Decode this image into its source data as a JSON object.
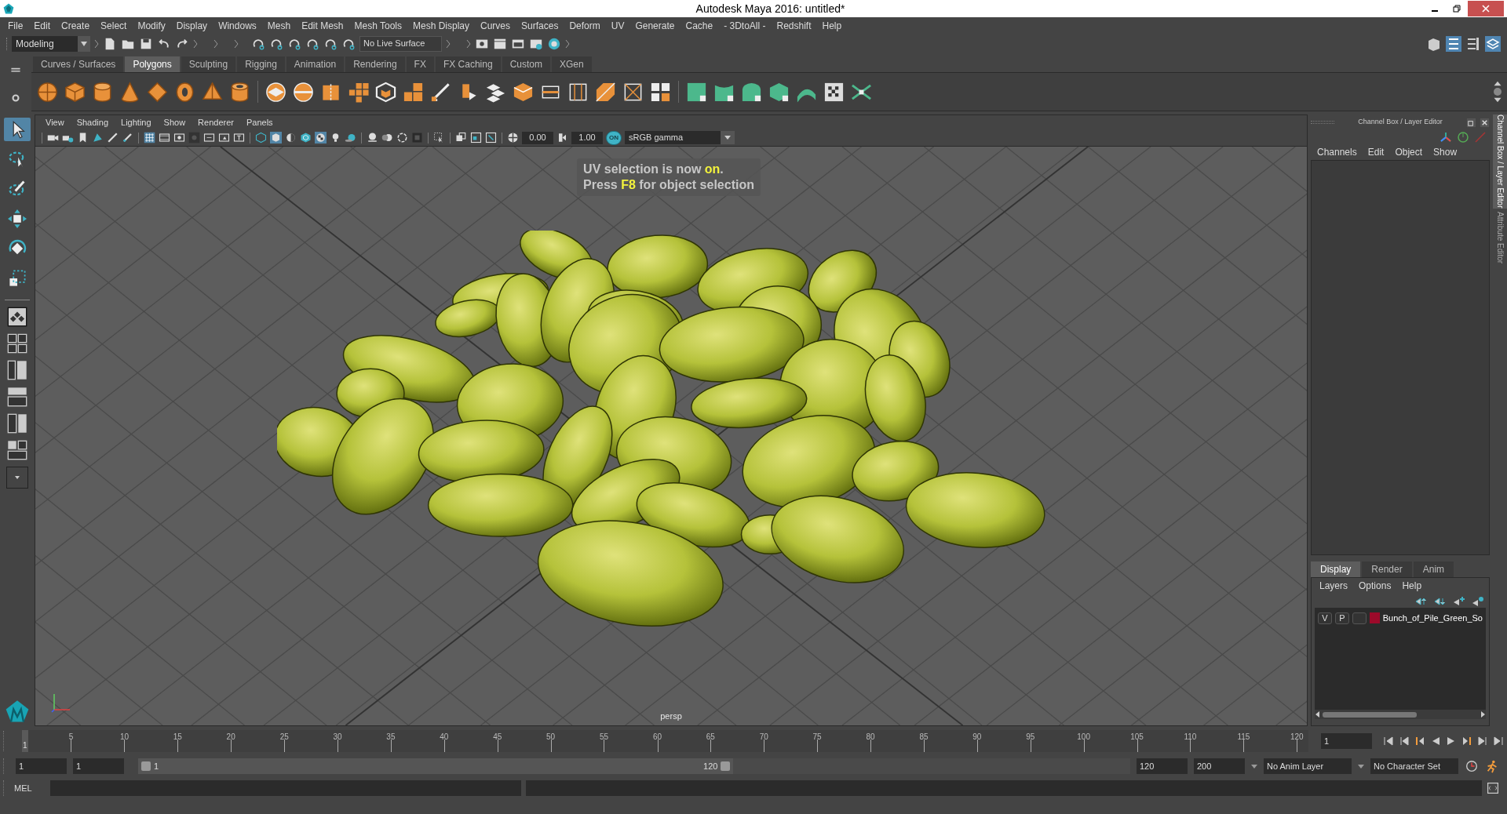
{
  "window": {
    "title": "Autodesk Maya 2016: untitled*"
  },
  "menu_bar": [
    "File",
    "Edit",
    "Create",
    "Select",
    "Modify",
    "Display",
    "Windows",
    "Mesh",
    "Edit Mesh",
    "Mesh Tools",
    "Mesh Display",
    "Curves",
    "Surfaces",
    "Deform",
    "UV",
    "Generate",
    "Cache",
    "- 3DtoAll -",
    "Redshift",
    "Help"
  ],
  "status_line": {
    "mode": "Modeling",
    "live_surface": "No Live Surface"
  },
  "shelf": {
    "tabs": [
      {
        "label": "Curves / Surfaces",
        "selected": false
      },
      {
        "label": "Polygons",
        "selected": true
      },
      {
        "label": "Sculpting",
        "selected": false
      },
      {
        "label": "Rigging",
        "selected": false
      },
      {
        "label": "Animation",
        "selected": false
      },
      {
        "label": "Rendering",
        "selected": false
      },
      {
        "label": "FX",
        "selected": false
      },
      {
        "label": "FX Caching",
        "selected": false
      },
      {
        "label": "Custom",
        "selected": false
      },
      {
        "label": "XGen",
        "selected": false
      }
    ]
  },
  "toolbox": {
    "tools": [
      {
        "selected": true
      },
      {
        "selected": false
      },
      {
        "selected": false
      },
      {
        "selected": false
      },
      {
        "selected": false
      },
      {
        "selected": false
      }
    ]
  },
  "viewport": {
    "menus": [
      "View",
      "Shading",
      "Lighting",
      "Show",
      "Renderer",
      "Panels"
    ],
    "exposure": "0.00",
    "gamma": "1.00",
    "color_management": "ON",
    "color_space": "sRGB gamma",
    "message": [
      "UV selection is now **on**.",
      "Press **F8** for object selection"
    ],
    "camera": "persp"
  },
  "channel_box": {
    "title": "Channel Box / Layer Editor",
    "menus": [
      "Channels",
      "Edit",
      "Object",
      "Show"
    ]
  },
  "layer_editor": {
    "tabs": [
      {
        "label": "Display",
        "selected": true
      },
      {
        "label": "Render",
        "selected": false
      },
      {
        "label": "Anim",
        "selected": false
      }
    ],
    "menus": [
      "Layers",
      "Options",
      "Help"
    ],
    "layers": [
      {
        "visibility": "V",
        "playback": "P",
        "color": "#9c0a2a",
        "name": "Bunch_of_Pile_Green_So"
      }
    ]
  },
  "side_tabs": [
    {
      "label": "Channel Box / Layer Editor",
      "selected": true
    },
    {
      "label": "Attribute Editor",
      "selected": false
    }
  ],
  "time_slider": {
    "start_label": "1",
    "ticks": [
      "5",
      "10",
      "15",
      "20",
      "25",
      "30",
      "35",
      "40",
      "45",
      "50",
      "55",
      "60",
      "65",
      "70",
      "75",
      "80",
      "85",
      "90",
      "95",
      "100",
      "105",
      "110",
      "115",
      "120"
    ],
    "current_frame": "1",
    "level": 0.0
  },
  "range_slider": {
    "start": "1",
    "playback_start": "1",
    "range_start": "1",
    "range_end": "120",
    "playback_end": "120",
    "end": "200",
    "level": 0.6,
    "anim_layer": "No Anim Layer",
    "character_set": "No Character Set"
  },
  "command_line": {
    "language": "MEL"
  }
}
